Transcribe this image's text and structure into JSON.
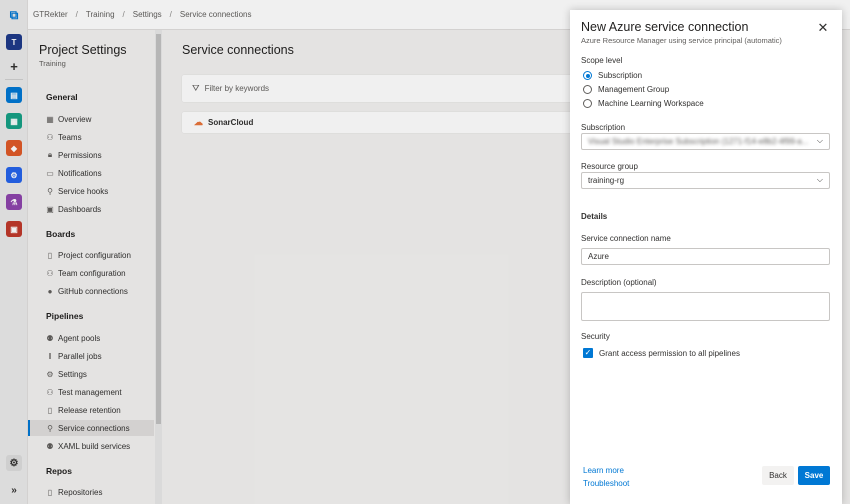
{
  "breadcrumb": [
    "GTRekter",
    "Training",
    "Settings",
    "Service connections"
  ],
  "rail": {
    "project_initial": "T",
    "colors": {
      "project": "#1e3a8a",
      "boards": "#0078d4",
      "repos": "#e05a28",
      "pipelines": "#2563eb",
      "test": "#8e44ad",
      "artifacts": "#c0392b"
    }
  },
  "nav": {
    "title": "Project Settings",
    "subtitle": "Training",
    "sections": {
      "general": "General",
      "boards": "Boards",
      "pipelines": "Pipelines",
      "repos": "Repos"
    },
    "items": {
      "overview": "Overview",
      "teams": "Teams",
      "permissions": "Permissions",
      "notifications": "Notifications",
      "service_hooks": "Service hooks",
      "dashboards": "Dashboards",
      "project_configuration": "Project configuration",
      "team_configuration": "Team configuration",
      "github_connections": "GitHub connections",
      "agent_pools": "Agent pools",
      "parallel_jobs": "Parallel jobs",
      "settings": "Settings",
      "test_management": "Test management",
      "release_retention": "Release retention",
      "service_connections": "Service connections",
      "xaml_build_services": "XAML build services",
      "repositories": "Repositories"
    },
    "active": "service_connections"
  },
  "main": {
    "title": "Service connections",
    "filter_placeholder": "Filter by keywords",
    "connections": [
      "SonarCloud"
    ]
  },
  "panel": {
    "title": "New Azure service connection",
    "subtitle": "Azure Resource Manager using service principal (automatic)",
    "scope_label": "Scope level",
    "scope_options": [
      "Subscription",
      "Management Group",
      "Machine Learning Workspace"
    ],
    "scope_selected": "Subscription",
    "subscription_label": "Subscription",
    "subscription_value": "Visual Studio Enterprise Subscription (1271-f14-e8b2-4f99-a...",
    "resource_group_label": "Resource group",
    "resource_group_value": "training-rg",
    "details_heading": "Details",
    "name_label": "Service connection name",
    "name_value": "Azure",
    "description_label": "Description (optional)",
    "description_value": "",
    "security_label": "Security",
    "grant_access_label": "Grant access permission to all pipelines",
    "grant_access_checked": true,
    "learn_more": "Learn more",
    "troubleshoot": "Troubleshoot",
    "back_label": "Back",
    "save_label": "Save"
  }
}
